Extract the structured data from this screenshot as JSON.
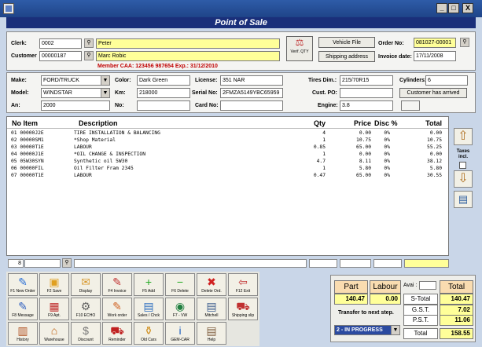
{
  "window": {
    "title": "Point of Sale",
    "controls": [
      "_",
      "□",
      "X"
    ]
  },
  "header": {
    "clerk_label": "Clerk:",
    "clerk_id": "0002",
    "clerk_name": "Peter",
    "customer_label": "Customer",
    "customer_id": "00000187",
    "customer_name": "Marc Robic",
    "member_line": "Member CAA: 123456 987654  Exp.: 31/12/2010",
    "verif_label": "Verif. QTY",
    "vehicle_file_label": "Vehicle File",
    "shipping_address_label": "Shipping address",
    "order_no_label": "Order No:",
    "order_no": "081027-00001",
    "invoice_date_label": "Invoice date:",
    "invoice_date": "17/11/2008"
  },
  "vehicle": {
    "make_label": "Make:",
    "make": "FORD/TRUCK",
    "model_label": "Model:",
    "model": "WINDSTAR",
    "year_label": "An:",
    "year": "2000",
    "color_label": "Color:",
    "color": "Dark Green",
    "km_label": "Km:",
    "km": "218000",
    "no_label": "No:",
    "no": "",
    "license_label": "License:",
    "license": "351 NAR",
    "serial_label": "Serial No:",
    "serial": "2FMZA5149YBC65959",
    "card_label": "Card No:",
    "card": "",
    "tires_label": "Tires Dim.:",
    "tires": "215/70R15",
    "custpo_label": "Cust. PO:",
    "custpo": "",
    "engine_label": "Engine:",
    "engine": "3.8",
    "cylinders_label": "Cylinders:",
    "cylinders": "6",
    "customer_arrived_label": "Customer has arrived"
  },
  "table": {
    "headers": {
      "no": "No Item",
      "desc": "Description",
      "qty": "Qty",
      "price": "Price",
      "disc": "Disc %",
      "total": "Total"
    },
    "rows": [
      {
        "item": "01 00000J2E",
        "desc": " TIRE INSTALLATION & BALANCING",
        "qty": "4",
        "price": "0.00",
        "disc": "0%",
        "total": "0.00"
      },
      {
        "item": "02 00000SM1",
        "desc": "*Shop Material",
        "qty": "1",
        "price": "10.75",
        "disc": "0%",
        "total": "10.75"
      },
      {
        "item": "03 00000T1E",
        "desc": " LABOUR",
        "qty": "0.85",
        "price": "65.00",
        "disc": "0%",
        "total": "55.25"
      },
      {
        "item": "04 00000J1E",
        "desc": "*OIL CHANGE & INSPECTION",
        "qty": "1",
        "price": "0.00",
        "disc": "0%",
        "total": "0.00"
      },
      {
        "item": "05 05W30SYN",
        "desc": "  Synthetic oil 5W30",
        "qty": "4.7",
        "price": "8.11",
        "disc": "0%",
        "total": "38.12"
      },
      {
        "item": "06 00000FIL",
        "desc": "  Oil Filter Fram 2345",
        "qty": "1",
        "price": "5.80",
        "disc": "0%",
        "total": "5.80"
      },
      {
        "item": "07 00000T1E",
        "desc": "  LABOUR",
        "qty": "0.47",
        "price": "65.00",
        "disc": "0%",
        "total": "30.55"
      }
    ],
    "line_count": "8",
    "taxes_label": "Taxes incl."
  },
  "buttons": [
    {
      "label": "F1 New Order",
      "icon": "new-order-icon",
      "glyph": "✎",
      "color": "#2a6fd6"
    },
    {
      "label": "F2 Save",
      "icon": "save-icon",
      "glyph": "▣",
      "color": "#e0a020"
    },
    {
      "label": "Display",
      "icon": "display-icon",
      "glyph": "✉",
      "color": "#d89a30"
    },
    {
      "label": "F4 Invoice",
      "icon": "invoice-icon",
      "glyph": "✎",
      "color": "#c03030"
    },
    {
      "label": "F5 Add",
      "icon": "add-icon",
      "glyph": "+",
      "color": "#22aa22"
    },
    {
      "label": "F6 Delete",
      "icon": "delete-icon",
      "glyph": "−",
      "color": "#22aa22"
    },
    {
      "label": "Delete Ord.",
      "icon": "delete-order-icon",
      "glyph": "✖",
      "color": "#d02020"
    },
    {
      "label": "F12 Exit",
      "icon": "exit-icon",
      "glyph": "⇦",
      "color": "#c03030"
    },
    {
      "label": "F8 Message",
      "icon": "message-icon",
      "glyph": "✎",
      "color": "#3060c0"
    },
    {
      "label": "F9 Apt.",
      "icon": "appointment-icon",
      "glyph": "▦",
      "color": "#c03030"
    },
    {
      "label": "F10 ECHO",
      "icon": "echo-icon",
      "glyph": "⚙",
      "color": "#606060"
    },
    {
      "label": "Work order",
      "icon": "work-order-icon",
      "glyph": "✎",
      "color": "#d06020"
    },
    {
      "label": "Sales / Chck",
      "icon": "sales-check-icon",
      "glyph": "▤",
      "color": "#3070c0"
    },
    {
      "label": "F7 - VW",
      "icon": "web-icon",
      "glyph": "◉",
      "color": "#208040"
    },
    {
      "label": "Mitchell",
      "icon": "mitchell-icon",
      "glyph": "▤",
      "color": "#406090"
    },
    {
      "label": "Shipping slip",
      "icon": "shipping-icon",
      "glyph": "⛟",
      "color": "#c03030"
    },
    {
      "label": "History",
      "icon": "history-icon",
      "glyph": "▥",
      "color": "#b05020"
    },
    {
      "label": "Warehouse",
      "icon": "warehouse-icon",
      "glyph": "⌂",
      "color": "#c06010"
    },
    {
      "label": "Discount",
      "icon": "discount-icon",
      "glyph": "$",
      "color": "#777777"
    },
    {
      "label": "Reminder",
      "icon": "reminder-icon",
      "glyph": "⛟",
      "color": "#c02020"
    },
    {
      "label": "Old Cars",
      "icon": "old-cars-icon",
      "glyph": "⚱",
      "color": "#d09020"
    },
    {
      "label": "GEM-CAR",
      "icon": "info-icon",
      "glyph": "i",
      "color": "#2060c0"
    },
    {
      "label": "Help",
      "icon": "help-icon",
      "glyph": "▤",
      "color": "#806040"
    }
  ],
  "totals": {
    "part_label": "Part",
    "labour_label": "Labour",
    "avai_label": "Avai :",
    "total_label": "Total",
    "part_value": "140.47",
    "labour_value": "0.00",
    "stotal_label": "S-Total",
    "stotal": "140.47",
    "gst_label": "G.S.T.",
    "gst": "7.02",
    "pst_label": "P.S.T.",
    "pst": "11.06",
    "grand_label": "Total",
    "grand": "158.55",
    "transfer_label": "Transfer to next step.",
    "status_value": "2 - IN PROGRESS"
  }
}
